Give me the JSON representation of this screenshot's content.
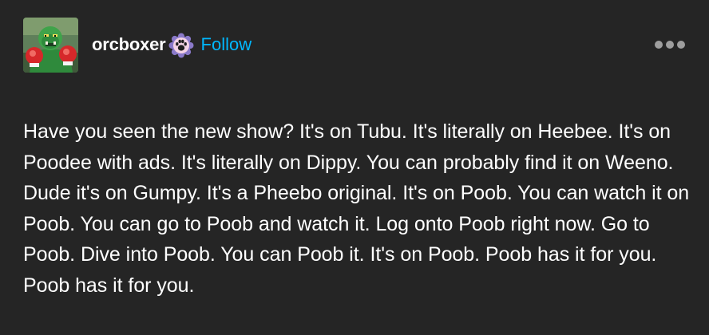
{
  "post": {
    "author": {
      "username": "orcboxer",
      "avatar_icon": "orc-boxer-avatar-icon",
      "badge_icon": "paw-badge-icon"
    },
    "follow_label": "Follow",
    "menu_icon": "more-dots-icon",
    "text": "Have you seen the new show? It's on Tubu. It's literally on Heebee. It's on Poodee with ads. It's literally on Dippy. You can probably find it on Weeno. Dude it's on Gumpy. It's a Pheebo original. It's on Poob. You can watch it on Poob. You can go to Poob and watch it. Log onto Poob right now. Go to Poob. Dive into Poob. You can Poob it. It's on Poob. Poob has it for you. Poob has it for you."
  },
  "colors": {
    "background": "#252525",
    "text": "#ffffff",
    "follow": "#00b8ff",
    "menu_dots": "#9e9e9e",
    "badge_outer": "#8a79c9",
    "badge_inner": "#f4d3e6"
  }
}
